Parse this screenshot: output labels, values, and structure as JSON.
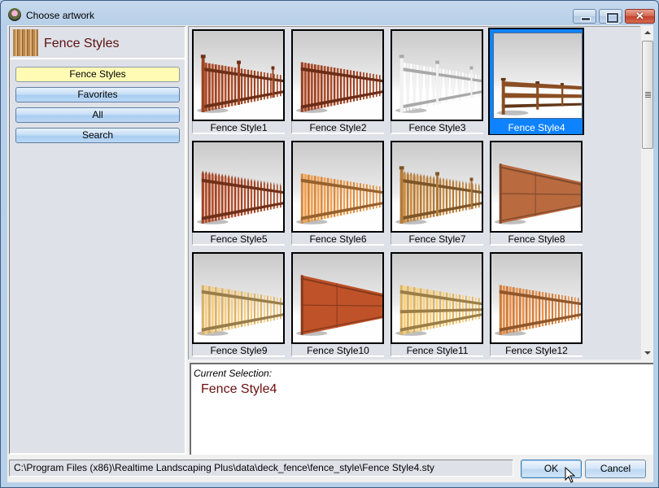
{
  "window": {
    "title": "Choose artwork",
    "caption_buttons": [
      "minimize",
      "maximize",
      "close"
    ],
    "close_glyph": "✕"
  },
  "sidebar": {
    "category_title": "Fence Styles",
    "buttons": [
      {
        "label": "Fence Styles",
        "active": true
      },
      {
        "label": "Favorites",
        "active": false
      },
      {
        "label": "All",
        "active": false
      },
      {
        "label": "Search",
        "active": false
      }
    ]
  },
  "gallery": {
    "selected_index": 3,
    "items": [
      {
        "label": "Fence Style1",
        "color": "#9c4322",
        "type": "picket-post"
      },
      {
        "label": "Fence Style2",
        "color": "#9a4021",
        "type": "picket"
      },
      {
        "label": "Fence Style3",
        "color": "#f2f2f2",
        "type": "picket-post"
      },
      {
        "label": "Fence Style4",
        "color": "#8b4e22",
        "type": "rail"
      },
      {
        "label": "Fence Style5",
        "color": "#a04424",
        "type": "pointed"
      },
      {
        "label": "Fence Style6",
        "color": "#d68a3f",
        "type": "picket"
      },
      {
        "label": "Fence Style7",
        "color": "#b27a37",
        "type": "pointed-post"
      },
      {
        "label": "Fence Style8",
        "color": "#b96a3f",
        "type": "board"
      },
      {
        "label": "Fence Style9",
        "color": "#d9b26a",
        "type": "picket"
      },
      {
        "label": "Fence Style10",
        "color": "#bf5228",
        "type": "board"
      },
      {
        "label": "Fence Style11",
        "color": "#ddb464",
        "type": "slat"
      },
      {
        "label": "Fence Style12",
        "color": "#cd7c3c",
        "type": "picket"
      }
    ]
  },
  "selection": {
    "caption": "Current Selection:",
    "value": "Fence Style4"
  },
  "status": {
    "path": "C:\\Program Files (x86)\\Realtime Landscaping Plus\\data\\deck_fence\\fence_style\\Fence Style4.sty"
  },
  "buttons": {
    "ok": "OK",
    "cancel": "Cancel"
  }
}
